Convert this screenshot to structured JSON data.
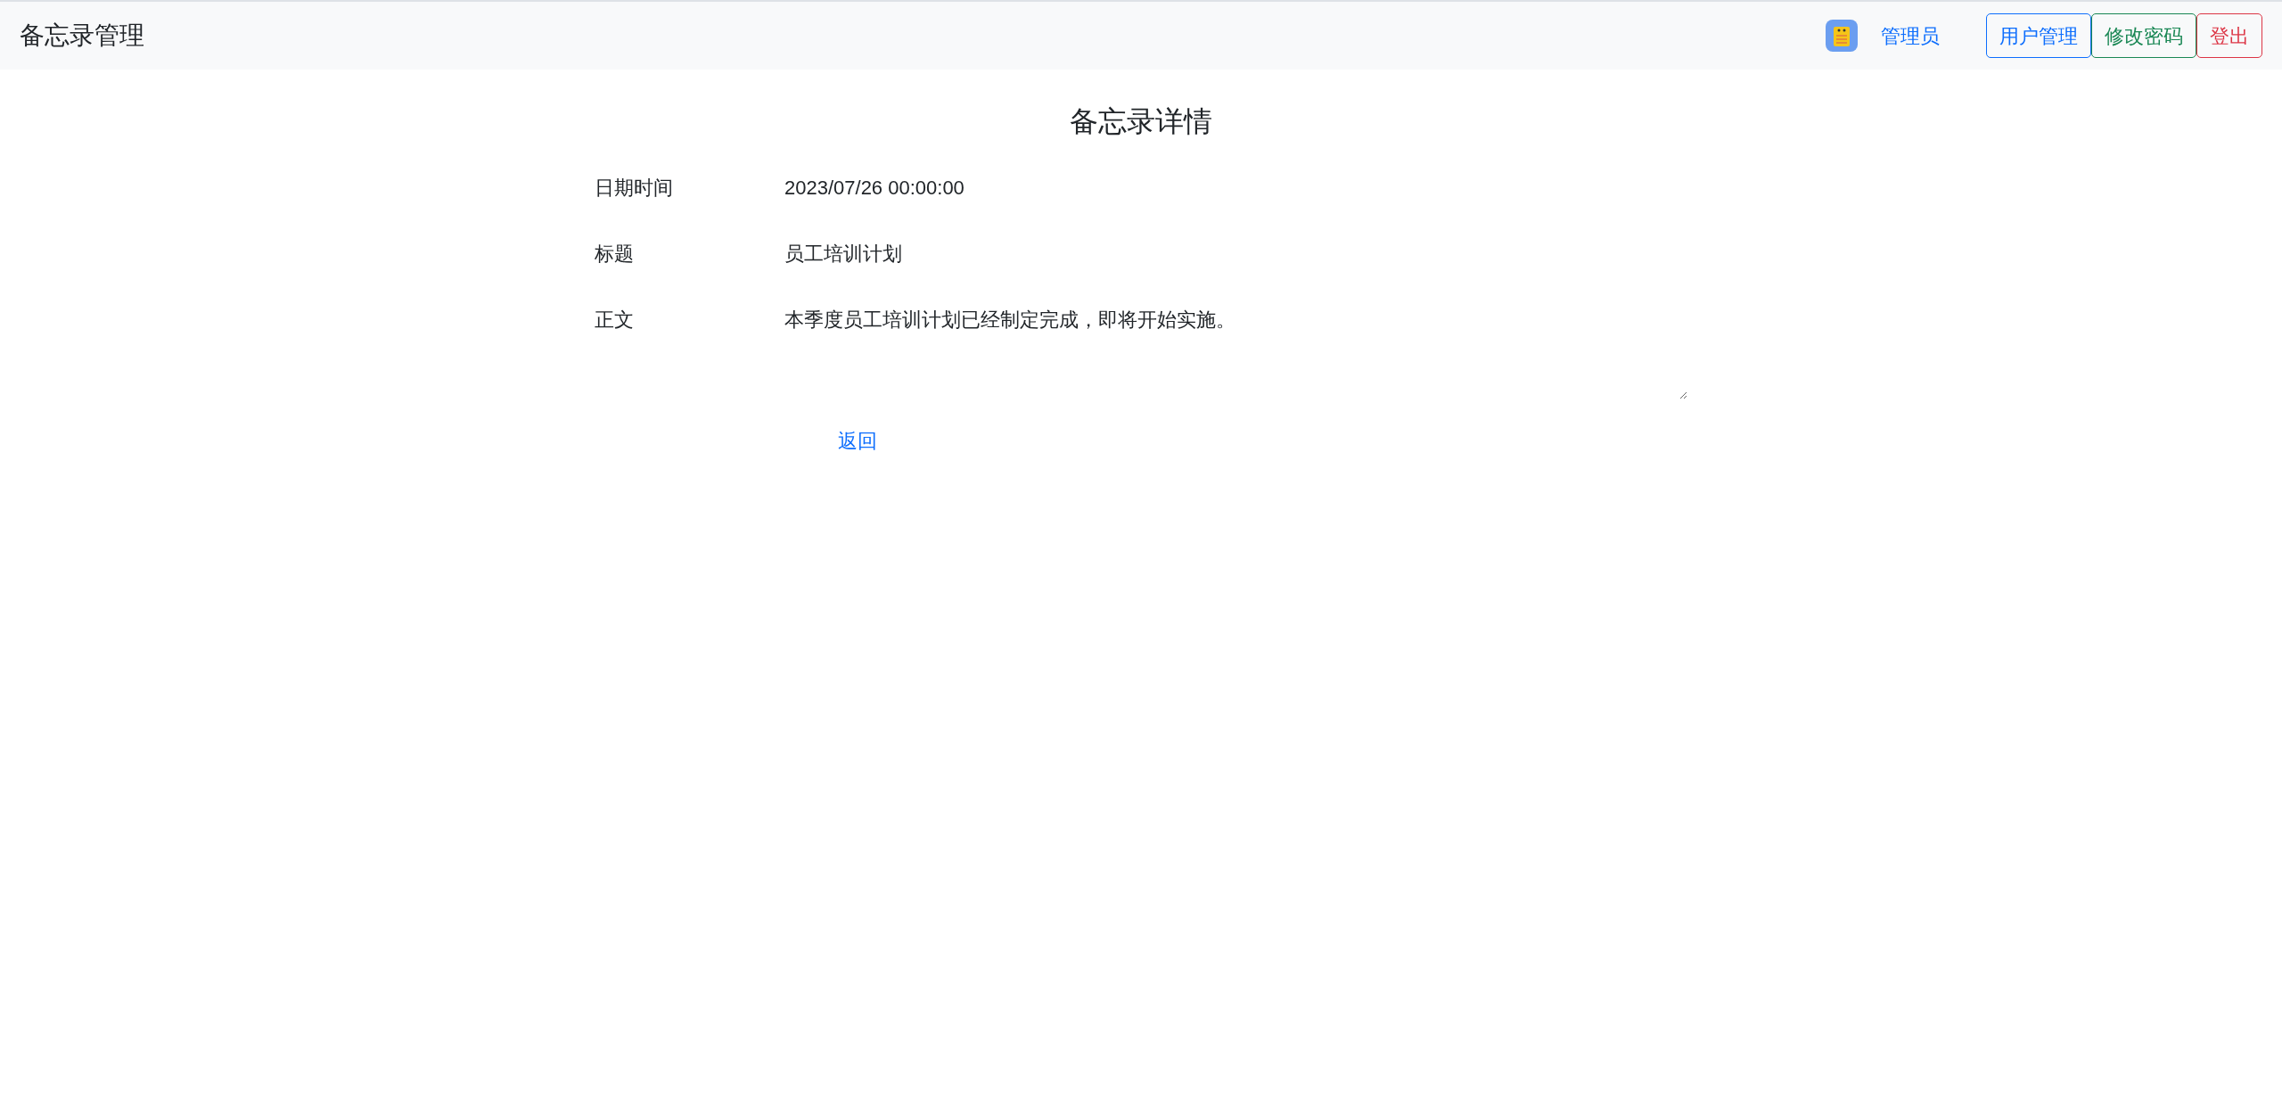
{
  "navbar": {
    "brand": "备忘录管理",
    "user": "管理员",
    "buttons": [
      {
        "label": "用户管理",
        "kind": "primary"
      },
      {
        "label": "修改密码",
        "kind": "success"
      },
      {
        "label": "登出",
        "kind": "danger"
      }
    ]
  },
  "page_title": "备忘录详情",
  "fields": [
    {
      "label": "日期时间",
      "value": "2023/07/26 00:00:00",
      "kind": "text"
    },
    {
      "label": "标题",
      "value": "员工培训计划",
      "kind": "text"
    },
    {
      "label": "正文",
      "value": "本季度员工培训计划已经制定完成，即将开始实施。",
      "kind": "textarea"
    }
  ],
  "back_link": "返回"
}
